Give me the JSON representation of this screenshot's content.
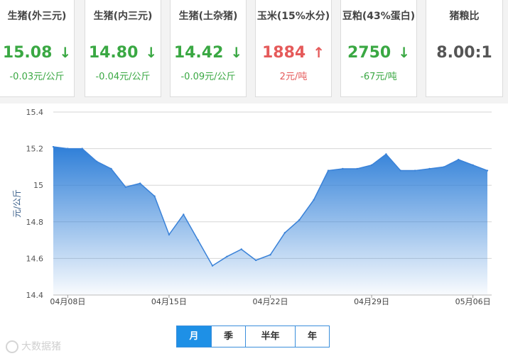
{
  "cards": [
    {
      "title": "生猪(外三元)",
      "value": "15.08",
      "arrow": "↓",
      "trend": "down",
      "change": "-0.03元/公斤"
    },
    {
      "title": "生猪(内三元)",
      "value": "14.80",
      "arrow": "↓",
      "trend": "down",
      "change": "-0.04元/公斤"
    },
    {
      "title": "生猪(土杂猪)",
      "value": "14.42",
      "arrow": "↓",
      "trend": "down",
      "change": "-0.09元/公斤"
    },
    {
      "title": "玉米(15%水分)",
      "value": "1884",
      "arrow": "↑",
      "trend": "up",
      "change": "2元/吨"
    },
    {
      "title": "豆粕(43%蛋白)",
      "value": "2750",
      "arrow": "↓",
      "trend": "down",
      "change": "-67元/吨"
    },
    {
      "title": "猪粮比",
      "value": "8.00:1",
      "arrow": "",
      "trend": "neutral",
      "change": ""
    }
  ],
  "colors": {
    "down": "#3aa843",
    "up": "#e55a5a",
    "line": "#3a82d8",
    "area_top": "#2f7fd8",
    "tab_active": "#1e90e6"
  },
  "chart_data": {
    "type": "area",
    "title": "",
    "xlabel": "",
    "ylabel": "元/公斤",
    "ylim": [
      14.4,
      15.4
    ],
    "yticks": [
      "14.4",
      "14.6",
      "14.8",
      "15",
      "15.2",
      "15.4"
    ],
    "ytick_values": [
      14.4,
      14.6,
      14.8,
      15.0,
      15.2,
      15.4
    ],
    "grid": true,
    "xtick_labels": [
      {
        "label": "04月08日",
        "index": 1
      },
      {
        "label": "04月15日",
        "index": 8
      },
      {
        "label": "04月22日",
        "index": 15
      },
      {
        "label": "04月29日",
        "index": 22
      },
      {
        "label": "05月06日",
        "index": 29
      }
    ],
    "series": [
      {
        "values": [
          15.21,
          15.2,
          15.2,
          15.13,
          15.09,
          14.99,
          15.01,
          14.94,
          14.73,
          14.84,
          14.7,
          14.56,
          14.61,
          14.65,
          14.59,
          14.62,
          14.74,
          14.81,
          14.92,
          15.08,
          15.09,
          15.09,
          15.11,
          15.17,
          15.08,
          15.08,
          15.09,
          15.1,
          15.14,
          15.11,
          15.08
        ]
      }
    ]
  },
  "tabs": [
    {
      "label": "月",
      "active": true
    },
    {
      "label": "季",
      "active": false
    },
    {
      "label": "半年",
      "active": false
    },
    {
      "label": "年",
      "active": false
    }
  ],
  "watermark": "大数据猪"
}
